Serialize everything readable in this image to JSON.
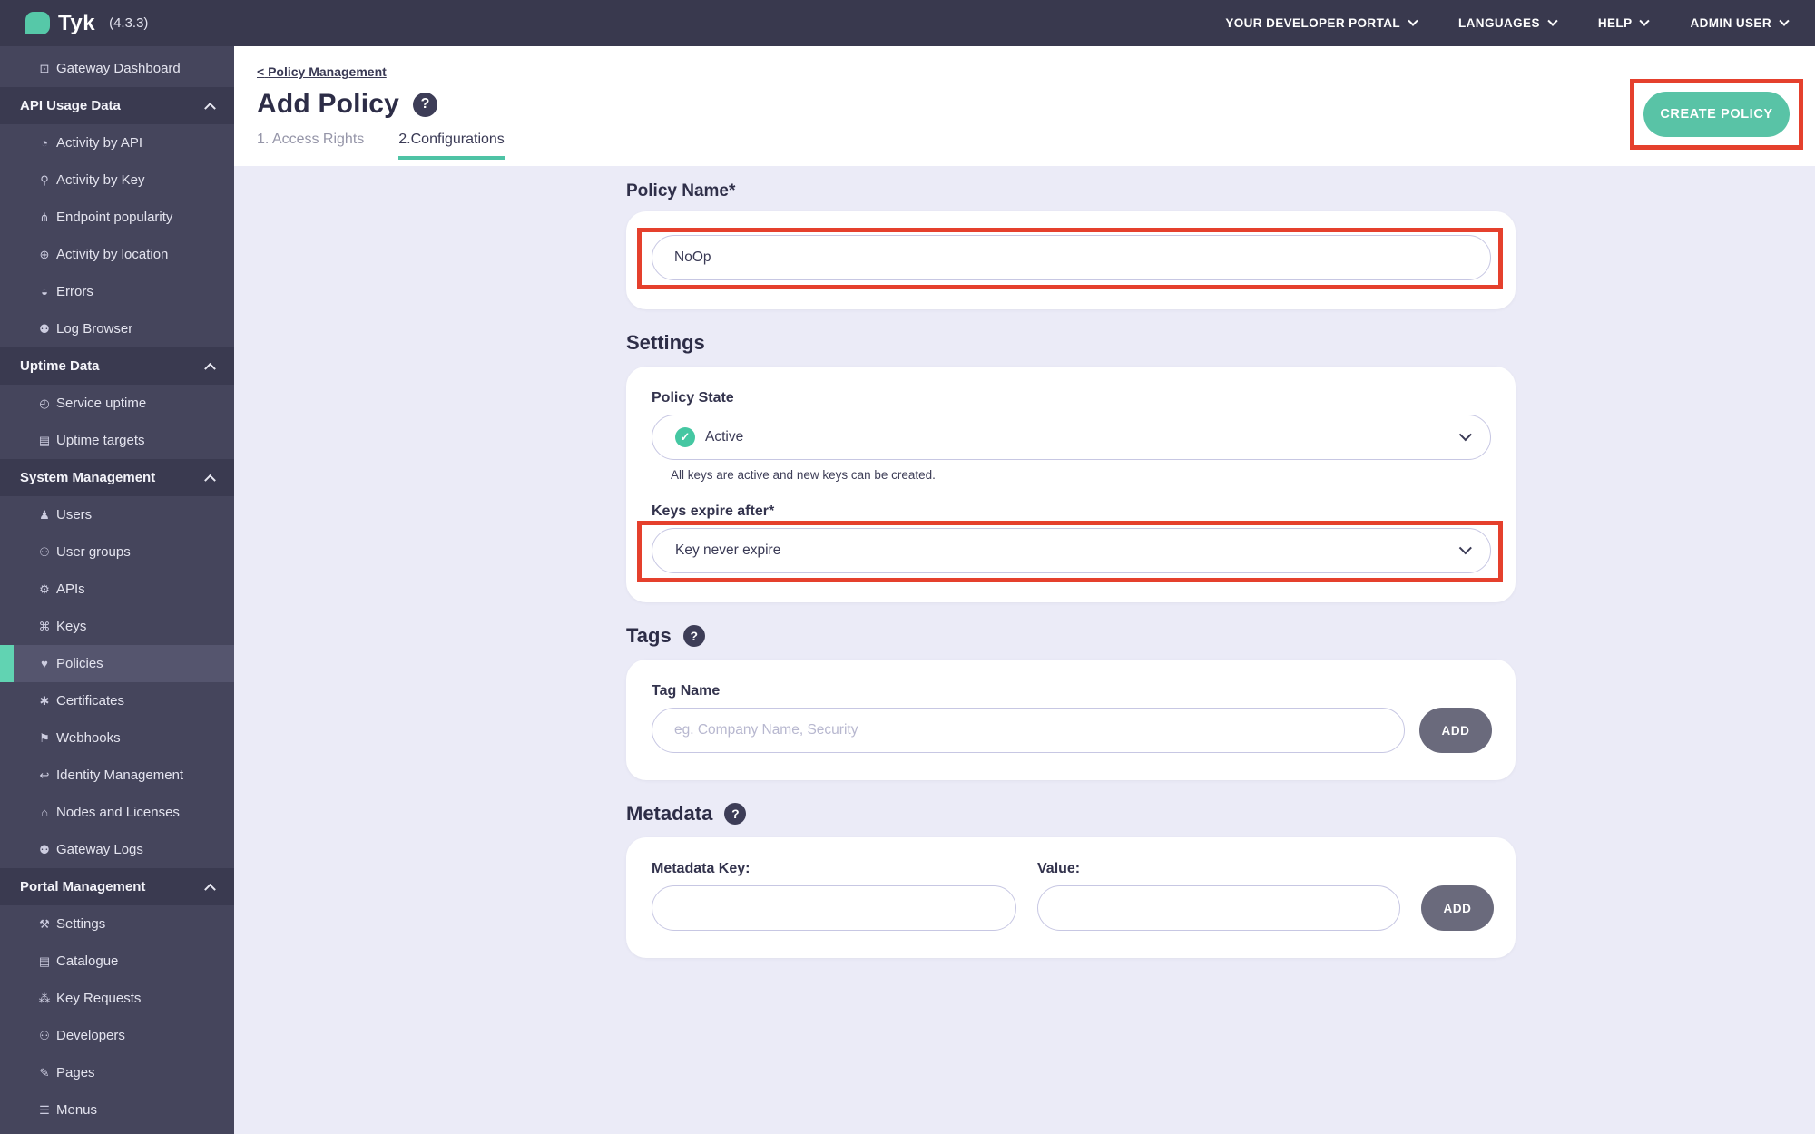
{
  "topbar": {
    "logo_text": "Tyk",
    "version": "(4.3.3)",
    "menus": [
      {
        "label": "YOUR DEVELOPER PORTAL",
        "slug": "your-developer-portal"
      },
      {
        "label": "LANGUAGES",
        "slug": "languages"
      },
      {
        "label": "HELP",
        "slug": "help"
      },
      {
        "label": "ADMIN USER",
        "slug": "admin-user"
      }
    ]
  },
  "sidebar": {
    "items": [
      {
        "kind": "item",
        "icon": "monitor-icon",
        "glyph": "⊡",
        "label": "Gateway Dashboard",
        "slug": "gateway-dashboard",
        "active": false
      },
      {
        "kind": "section",
        "icon": "chevron-up-icon",
        "label": "API Usage Data",
        "slug": "api-usage-data"
      },
      {
        "kind": "item",
        "icon": "gauge-icon",
        "glyph": "◔",
        "label": "Activity by API",
        "slug": "activity-by-api",
        "active": false
      },
      {
        "kind": "item",
        "icon": "key-icon",
        "glyph": "⚲",
        "label": "Activity by Key",
        "slug": "activity-by-key",
        "active": false
      },
      {
        "kind": "item",
        "icon": "fork-icon",
        "glyph": "⋔",
        "label": "Endpoint popularity",
        "slug": "endpoint-popularity",
        "active": false
      },
      {
        "kind": "item",
        "icon": "globe-icon",
        "glyph": "⊕",
        "label": "Activity by location",
        "slug": "activity-by-location",
        "active": false
      },
      {
        "kind": "item",
        "icon": "error-icon",
        "glyph": "◒",
        "label": "Errors",
        "slug": "errors",
        "active": false
      },
      {
        "kind": "item",
        "icon": "bug-icon",
        "glyph": "⚉",
        "label": "Log Browser",
        "slug": "log-browser",
        "active": false
      },
      {
        "kind": "section",
        "icon": "chevron-up-icon",
        "label": "Uptime Data",
        "slug": "uptime-data"
      },
      {
        "kind": "item",
        "icon": "uptime-icon",
        "glyph": "◴",
        "label": "Service uptime",
        "slug": "service-uptime",
        "active": false
      },
      {
        "kind": "item",
        "icon": "list-icon",
        "glyph": "▤",
        "label": "Uptime targets",
        "slug": "uptime-targets",
        "active": false
      },
      {
        "kind": "section",
        "icon": "chevron-up-icon",
        "label": "System Management",
        "slug": "system-management"
      },
      {
        "kind": "item",
        "icon": "user-icon",
        "glyph": "♟",
        "label": "Users",
        "slug": "users",
        "active": false
      },
      {
        "kind": "item",
        "icon": "user-group-icon",
        "glyph": "⚇",
        "label": "User groups",
        "slug": "user-groups",
        "active": false
      },
      {
        "kind": "item",
        "icon": "gears-icon",
        "glyph": "⚙",
        "label": "APIs",
        "slug": "apis",
        "active": false
      },
      {
        "kind": "item",
        "icon": "network-icon",
        "glyph": "⌘",
        "label": "Keys",
        "slug": "keys",
        "active": false
      },
      {
        "kind": "item",
        "icon": "policy-icon",
        "glyph": "♥",
        "label": "Policies",
        "slug": "policies",
        "active": true
      },
      {
        "kind": "item",
        "icon": "certificate-icon",
        "glyph": "✱",
        "label": "Certificates",
        "slug": "certificates",
        "active": false
      },
      {
        "kind": "item",
        "icon": "bell-icon",
        "glyph": "⚑",
        "label": "Webhooks",
        "slug": "webhooks",
        "active": false
      },
      {
        "kind": "item",
        "icon": "identity-arrow-icon",
        "glyph": "↩",
        "label": "Identity Management",
        "slug": "identity-management",
        "active": false
      },
      {
        "kind": "item",
        "icon": "bank-icon",
        "glyph": "⌂",
        "label": "Nodes and Licenses",
        "slug": "nodes-and-licenses",
        "active": false
      },
      {
        "kind": "item",
        "icon": "bug-icon",
        "glyph": "⚉",
        "label": "Gateway Logs",
        "slug": "gateway-logs",
        "active": false
      },
      {
        "kind": "section",
        "icon": "chevron-up-icon",
        "label": "Portal Management",
        "slug": "portal-management"
      },
      {
        "kind": "item",
        "icon": "wrench-icon",
        "glyph": "⚒",
        "label": "Settings",
        "slug": "portal-settings",
        "active": false
      },
      {
        "kind": "item",
        "icon": "catalogue-icon",
        "glyph": "▤",
        "label": "Catalogue",
        "slug": "catalogue",
        "active": false
      },
      {
        "kind": "item",
        "icon": "paw-icon",
        "glyph": "⁂",
        "label": "Key Requests",
        "slug": "key-requests",
        "active": false
      },
      {
        "kind": "item",
        "icon": "developers-icon",
        "glyph": "⚇",
        "label": "Developers",
        "slug": "developers",
        "active": false
      },
      {
        "kind": "item",
        "icon": "page-icon",
        "glyph": "✎",
        "label": "Pages",
        "slug": "pages",
        "active": false
      },
      {
        "kind": "item",
        "icon": "menu-icon",
        "glyph": "☰",
        "label": "Menus",
        "slug": "menus",
        "active": false
      }
    ]
  },
  "page": {
    "breadcrumb_chevron": "<",
    "breadcrumb": "Policy Management",
    "title": "Add Policy",
    "title_help": "?",
    "tabs": [
      {
        "label": "1. Access Rights",
        "active": false
      },
      {
        "label": "2.Configurations",
        "active": true
      }
    ],
    "create_button": "CREATE POLICY"
  },
  "form": {
    "policy_name": {
      "label": "Policy Name*",
      "value": "NoOp"
    },
    "settings": {
      "heading": "Settings",
      "policy_state": {
        "label": "Policy State",
        "value": "Active",
        "check_glyph": "✓",
        "helper": "All keys are active and new keys can be created."
      },
      "keys_expire": {
        "label": "Keys expire after*",
        "value": "Key never expire"
      }
    },
    "tags": {
      "heading": "Tags",
      "help": "?",
      "field_label": "Tag Name",
      "placeholder": "eg. Company Name, Security",
      "add_label": "ADD"
    },
    "metadata": {
      "heading": "Metadata",
      "help": "?",
      "key_label": "Metadata Key:",
      "value_label": "Value:",
      "add_label": "ADD"
    }
  },
  "colors": {
    "accent_teal": "#59c3a6",
    "annotation_red": "#e5402d",
    "topbar_bg": "#39394e",
    "sidebar_bg": "#45455c",
    "sidebar_active_bg": "#55556e",
    "content_bg": "#ebebf7"
  }
}
